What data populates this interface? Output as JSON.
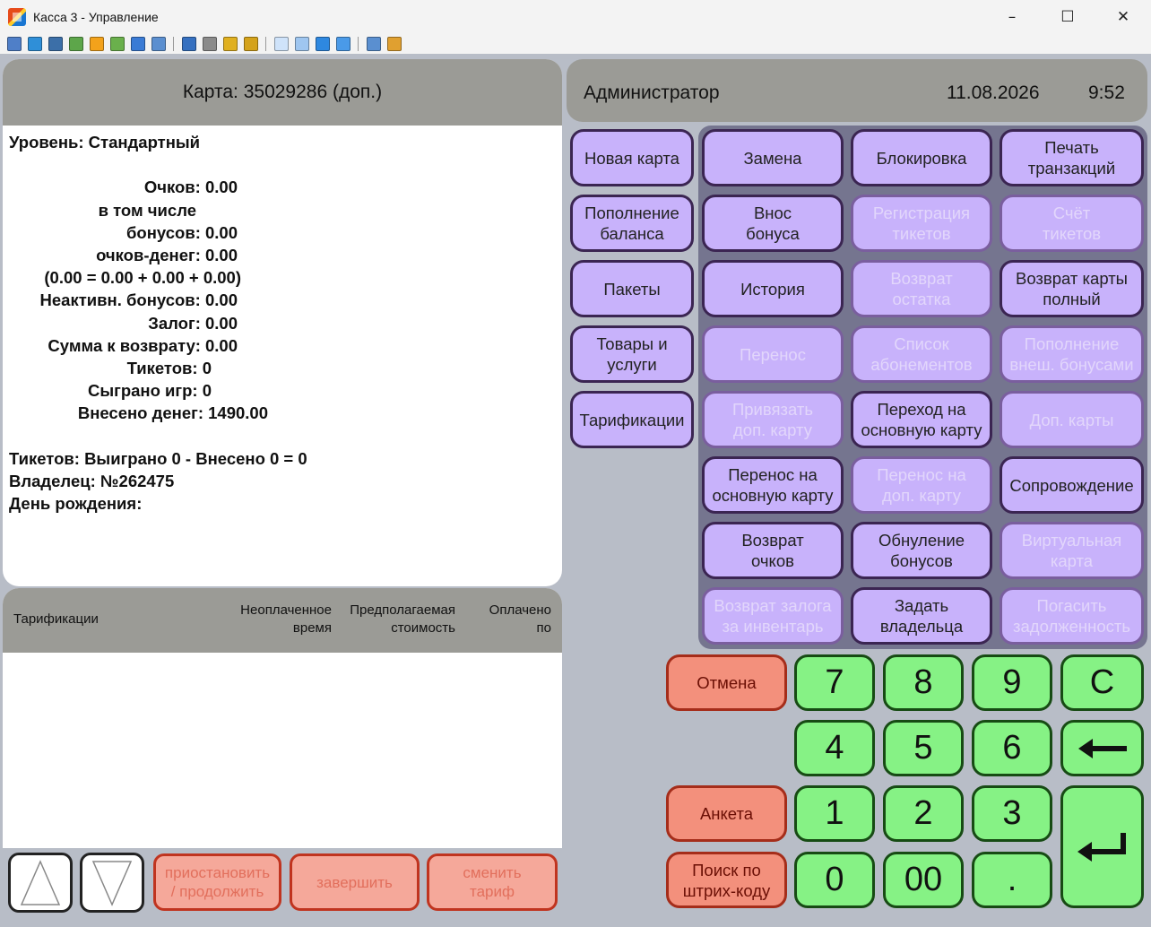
{
  "window": {
    "title": "Касса 3 - Управление"
  },
  "card": {
    "header": "Карта: 35029286 (доп.)",
    "level": "Уровень: Стандартный",
    "points": "Очков: 0.00",
    "including": "в том числе",
    "bonuses": "бонусов: 0.00",
    "points_money": "очков-денег: 0.00",
    "formula": "(0.00 = 0.00 + 0.00 + 0.00)",
    "inactive_bonuses": "Неактивн. бонусов: 0.00",
    "deposit": "Залог: 0.00",
    "refund_sum": "Сумма к возврату: 0.00",
    "tickets": "Тикетов: 0",
    "games_played": "Сыграно игр: 0",
    "money_deposited": "Внесено денег: 1490.00",
    "tickets_summary": "Тикетов: Выиграно 0 - Внесено 0 = 0",
    "owner": "Владелец: №262475",
    "birthday": "День рождения:"
  },
  "tariff_table": {
    "col_name": "Тарификации",
    "col_unpaid_1": "Неоплаченное",
    "col_unpaid_2": "время",
    "col_cost_1": "Предполагаемая",
    "col_cost_2": "стоимость",
    "col_paid_1": "Оплачено",
    "col_paid_2": "по"
  },
  "bottom_buttons": {
    "pause_1": "приостановить",
    "pause_2": "/ продолжить",
    "finish": "завершить",
    "change_1": "сменить",
    "change_2": "тариф"
  },
  "status": {
    "user": "Администратор",
    "date": "11.08.2026",
    "time": "9:52"
  },
  "side_actions": {
    "new_card": "Новая карта",
    "topup_1": "Пополнение",
    "topup_2": "баланса",
    "packages": "Пакеты",
    "goods_1": "Товары и",
    "goods_2": "услуги",
    "tariffs": "Тарификации"
  },
  "grid": {
    "replace": "Замена",
    "block": "Блокировка",
    "print_1": "Печать",
    "print_2": "транзакций",
    "bonus_1": "Внос",
    "bonus_2": "бонуса",
    "reg_tickets_1": "Регистрация",
    "reg_tickets_2": "тикетов",
    "count_tickets_1": "Счёт",
    "count_tickets_2": "тикетов",
    "history": "История",
    "return_rest_1": "Возврат",
    "return_rest_2": "остатка",
    "return_full_1": "Возврат карты",
    "return_full_2": "полный",
    "transfer": "Перенос",
    "subs_1": "Список",
    "subs_2": "абонементов",
    "ext_bonus_1": "Пополнение",
    "ext_bonus_2": "внеш. бонусами",
    "bind_1": "Привязать",
    "bind_2": "доп. карту",
    "go_main_1": "Переход на",
    "go_main_2": "основную карту",
    "add_cards": "Доп. карты",
    "move_main_1": "Перенос на",
    "move_main_2": "основную карту",
    "move_add_1": "Перенос на",
    "move_add_2": "доп. карту",
    "escort": "Сопровождение",
    "ret_points_1": "Возврат",
    "ret_points_2": "очков",
    "reset_bonus_1": "Обнуление",
    "reset_bonus_2": "бонусов",
    "virtual_1": "Виртуальная",
    "virtual_2": "карта",
    "ret_deposit_1": "Возврат залога",
    "ret_deposit_2": "за инвентарь",
    "set_owner_1": "Задать",
    "set_owner_2": "владельца",
    "pay_debt_1": "Погасить",
    "pay_debt_2": "задолженность"
  },
  "keypad": {
    "cancel": "Отмена",
    "form": "Анкета",
    "barcode_1": "Поиск по",
    "barcode_2": "штрих-коду",
    "k7": "7",
    "k8": "8",
    "k9": "9",
    "kc": "C",
    "k4": "4",
    "k5": "5",
    "k6": "6",
    "k1": "1",
    "k2": "2",
    "k3": "3",
    "k0": "0",
    "k00": "00",
    "kdot": "."
  },
  "colors": {
    "action_button": "#c8b2fb",
    "keypad_button": "#86f285",
    "cancel_button": "#f3907c",
    "header_gray": "#9b9b96"
  }
}
